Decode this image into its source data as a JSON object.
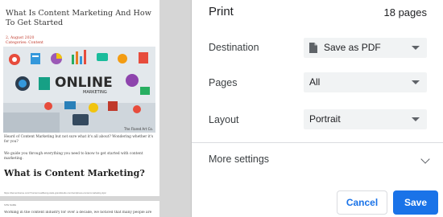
{
  "print": {
    "title": "Print",
    "page_count": "18 pages",
    "destination": {
      "label": "Destination",
      "value": "Save as PDF"
    },
    "pages": {
      "label": "Pages",
      "value": "All"
    },
    "layout": {
      "label": "Layout",
      "value": "Portrait"
    },
    "more_settings": "More settings",
    "cancel_label": "Cancel",
    "save_label": "Save"
  },
  "preview": {
    "article_title": "What Is Content Marketing And How To Get Started",
    "date": "2, August 2020",
    "category": "Categories: Content",
    "hero_text": "ONLINE",
    "hero_subtext": "MARKETING",
    "hero_caption": "The Flared Art Co.",
    "paragraph1": "Heard of Content Marketing but not sure what it's all about? Wondering whether it's for you?",
    "paragraph2": "We guide you through everything you need to know to get started with content marketing.",
    "heading": "What is Content Marketing?",
    "footer_url": "https://dementiverse.com/?content-wellbeing-stats-grandstudio.com/wordpress-content-marketing-tips/",
    "page2_header": "SITE NAME",
    "page2_text": "Working in the content industry for over a decade, we noticed that many people are"
  },
  "colors": {
    "accent": "#1a73e8",
    "preview_bg": "#d6d6d6",
    "select_bg": "#f1f3f4"
  }
}
